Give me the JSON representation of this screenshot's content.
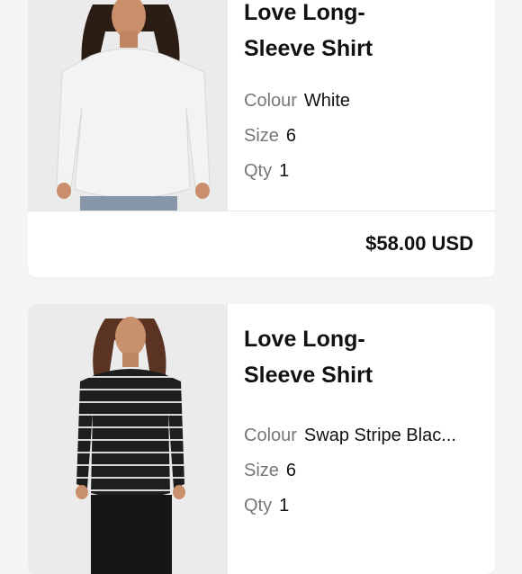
{
  "items": [
    {
      "title_line1": "Love Long-",
      "title_line2": "Sleeve Shirt",
      "colour_label": "Colour",
      "colour_value": "White",
      "size_label": "Size",
      "size_value": "6",
      "qty_label": "Qty",
      "qty_value": "1",
      "price": "$58.00 USD",
      "shirt_color": "#f2f2f2"
    },
    {
      "title_line1": "Love Long-",
      "title_line2": "Sleeve Shirt",
      "colour_label": "Colour",
      "colour_value": "Swap Stripe Blac...",
      "size_label": "Size",
      "size_value": "6",
      "qty_label": "Qty",
      "qty_value": "1",
      "shirt_color": "#1e1e1e"
    }
  ]
}
